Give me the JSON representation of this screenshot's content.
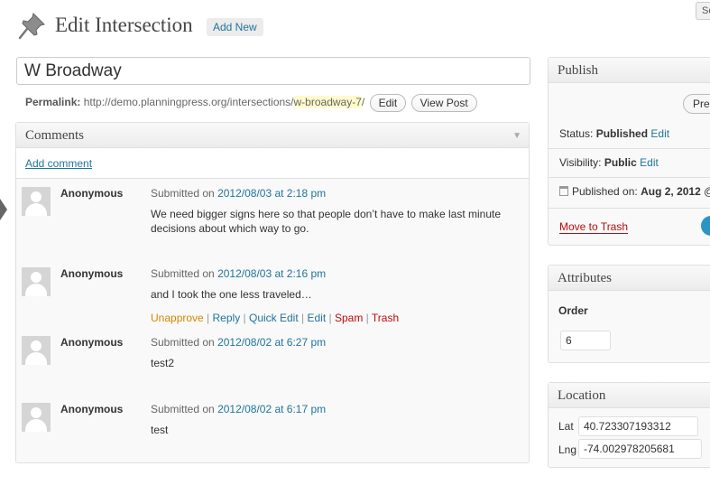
{
  "header": {
    "title": "Edit Intersection",
    "add_new": "Add New",
    "screen_options": "Sc"
  },
  "post": {
    "title": "W Broadway",
    "permalink_label": "Permalink:",
    "permalink_base": "http://demo.planningpress.org/intersections/",
    "permalink_slug": "w-broadway-7",
    "permalink_tail": "/",
    "edit_button": "Edit",
    "view_button": "View Post"
  },
  "comments": {
    "heading": "Comments",
    "add_comment": "Add comment",
    "submitted_prefix": "Submitted on",
    "items": [
      {
        "author": "Anonymous",
        "date": "2012/08/03 at 2:18 pm",
        "text": "We need bigger signs here so that people don’t have to make last minute decisions about which way to go."
      },
      {
        "author": "Anonymous",
        "date": "2012/08/03 at 2:16 pm",
        "text": "and I took the one less traveled…"
      },
      {
        "author": "Anonymous",
        "date": "2012/08/02 at 6:27 pm",
        "text": "test2"
      },
      {
        "author": "Anonymous",
        "date": "2012/08/02 at 6:17 pm",
        "text": "test"
      }
    ],
    "actions": {
      "unapprove": "Unapprove",
      "reply": "Reply",
      "quick_edit": "Quick Edit",
      "edit": "Edit",
      "spam": "Spam",
      "trash": "Trash",
      "separator": " | "
    }
  },
  "publish": {
    "heading": "Publish",
    "preview": "Pre",
    "status_label": "Status:",
    "status_value": "Published",
    "visibility_label": "Visibility:",
    "visibility_value": "Public",
    "edit": "Edit",
    "published_on_label": "Published on:",
    "published_on_value": "Aug 2, 2012",
    "published_trailing": "@",
    "move_to_trash": "Move to Trash"
  },
  "attributes": {
    "heading": "Attributes",
    "order_label": "Order",
    "order_value": "6"
  },
  "location": {
    "heading": "Location",
    "lat_label": "Lat",
    "lat_value": "40.723307193312",
    "lng_label": "Lng",
    "lng_value": "-74.002978205681"
  },
  "colors": {
    "link": "#21759b",
    "unapprove": "#d98500",
    "danger": "#bc0b0b",
    "slug_highlight": "#fffbcc",
    "update_button": "#2a95c5"
  }
}
